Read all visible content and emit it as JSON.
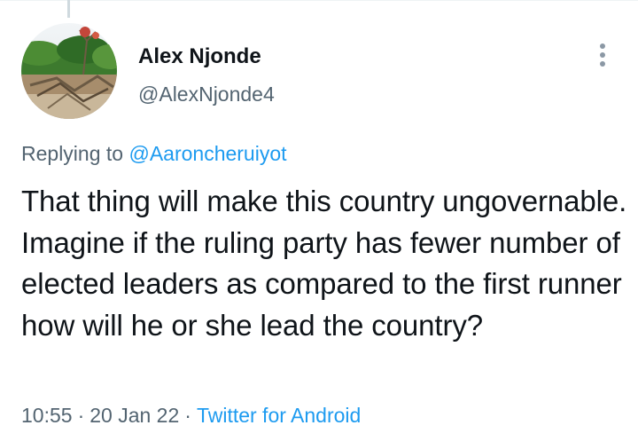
{
  "tweet": {
    "author": {
      "display_name": "Alex Njonde",
      "handle": "@AlexNjonde4"
    },
    "replying_prefix": "Replying to",
    "replying_to": "@Aaroncheruiyot",
    "text": "That thing will make this country ungovernable. Imagine if the ruling party has fewer number of elected leaders as compared to the first runner how will he or she lead the country?",
    "time": "10:55",
    "date": "20 Jan 22",
    "separator": "·",
    "source": "Twitter for Android"
  },
  "icons": {
    "more": "more-vertical-icon"
  },
  "colors": {
    "accent": "#1d9bf0",
    "secondary_text": "#536471",
    "primary_text": "#0f1419",
    "thread_line": "#cfd9de"
  }
}
